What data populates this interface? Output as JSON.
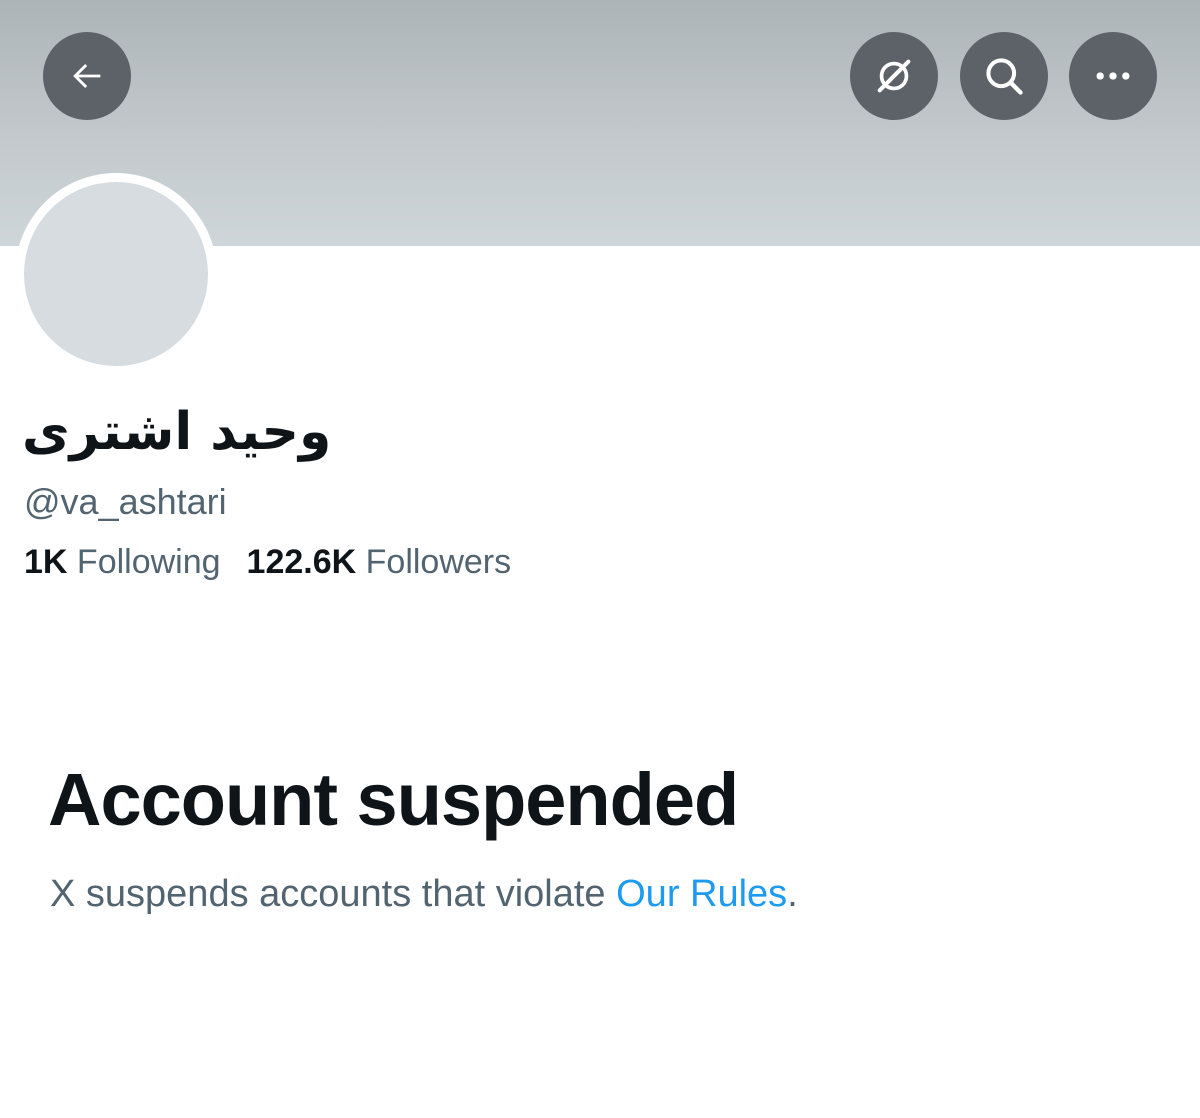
{
  "header": {
    "back_icon": "arrow-left-icon",
    "grok_icon": "grok-icon",
    "search_icon": "search-icon",
    "more_icon": "more-horizontal-icon",
    "button_color": "#5d6268",
    "banner_color": "#c2c8cc"
  },
  "profile": {
    "display_name": "وحید اشتری",
    "handle": "@va_ashtari",
    "avatar_color": "#d6dce0",
    "following_count": "1K",
    "following_label": "Following",
    "followers_count": "122.6K",
    "followers_label": "Followers"
  },
  "notice": {
    "title": "Account suspended",
    "description_prefix": "X suspends accounts that violate ",
    "link_label": "Our Rules",
    "description_suffix": ".",
    "link_color": "#1d9bf0"
  }
}
